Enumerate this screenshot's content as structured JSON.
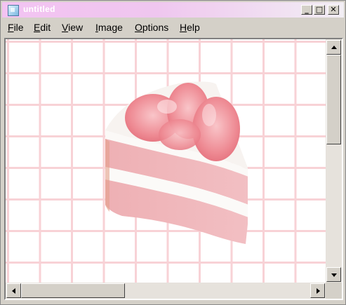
{
  "window": {
    "title": "untitled",
    "controls": {
      "minimize": "_",
      "maximize": "□",
      "close": "✕"
    }
  },
  "menu": {
    "items": [
      {
        "key": "F",
        "rest": "ile"
      },
      {
        "key": "E",
        "rest": "dit"
      },
      {
        "key": "V",
        "rest": "iew"
      },
      {
        "key": "I",
        "rest": "mage"
      },
      {
        "key": "O",
        "rest": "ptions"
      },
      {
        "key": "H",
        "rest": "elp"
      }
    ]
  },
  "canvas": {
    "image": "cake-slice",
    "grid_color": "#f8d2d6",
    "background": "#ffffff"
  },
  "icons": {
    "app": "paint-app-icon",
    "scroll_up": "up-arrow-icon",
    "scroll_down": "down-arrow-icon",
    "scroll_left": "left-arrow-icon",
    "scroll_right": "right-arrow-icon"
  }
}
